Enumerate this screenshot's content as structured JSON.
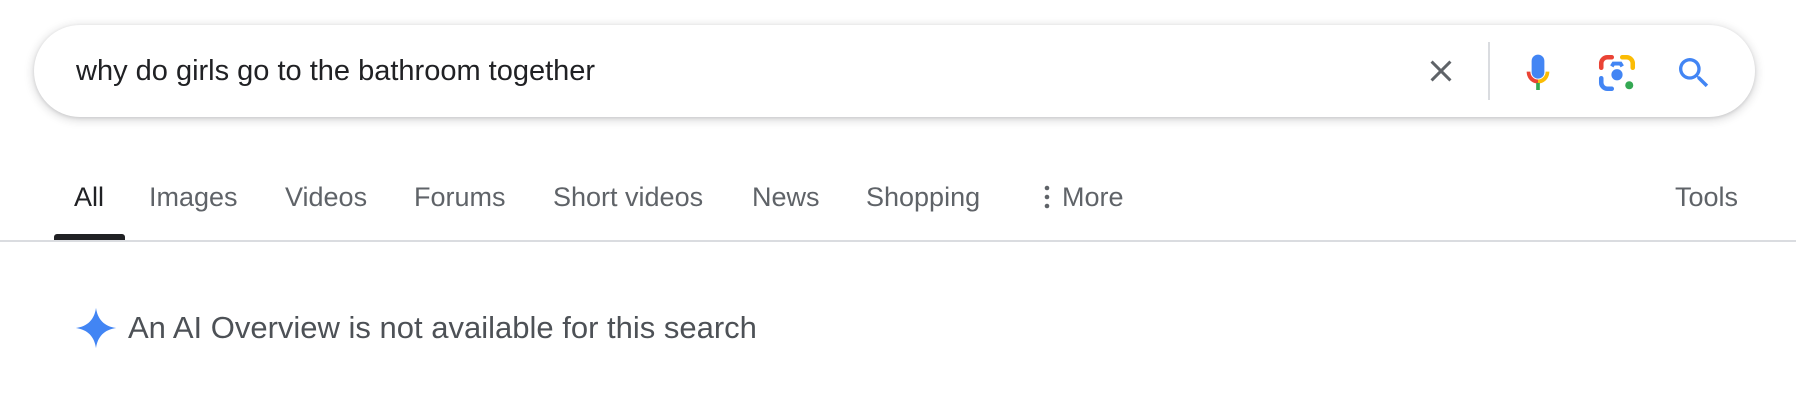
{
  "search": {
    "query": "why do girls go to the bathroom together",
    "icons": {
      "clear": "close-icon",
      "voice": "microphone-icon",
      "lens": "camera-lens-icon",
      "search": "search-icon"
    }
  },
  "tabs": [
    {
      "label": "All",
      "active": true
    },
    {
      "label": "Images"
    },
    {
      "label": "Videos"
    },
    {
      "label": "Forums"
    },
    {
      "label": "Short videos"
    },
    {
      "label": "News"
    },
    {
      "label": "Shopping"
    },
    {
      "label": "More",
      "icon": "vertical-dots-icon"
    }
  ],
  "tools_label": "Tools",
  "ai_overview": {
    "icon": "sparkle-icon",
    "message": "An AI Overview is not available for this search"
  },
  "colors": {
    "google_blue": "#4285F4",
    "google_red": "#EA4335",
    "google_yellow": "#FBBC04",
    "google_green": "#34A853",
    "text_primary": "#202124",
    "text_secondary": "#5f6368"
  }
}
